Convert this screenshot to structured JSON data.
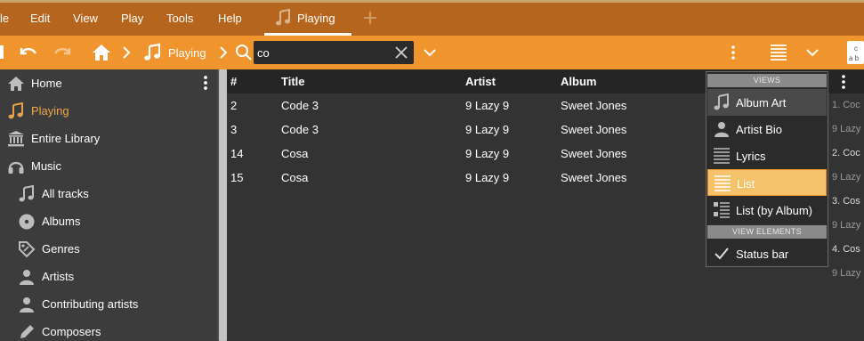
{
  "menubar": {
    "items": [
      "le",
      "Edit",
      "View",
      "Play",
      "Tools",
      "Help"
    ],
    "tab": {
      "label": "Playing",
      "icon": "music-note-icon"
    },
    "add_tab_icon": "plus-icon"
  },
  "toolbar": {
    "breadcrumb": [
      "Playing"
    ],
    "search": {
      "value": "co",
      "placeholder": ""
    },
    "icons": [
      "undo-icon",
      "redo-icon",
      "home-icon",
      "chevron-right-icon",
      "search-icon",
      "clear-icon",
      "chevron-down-icon",
      "kebab-menu-icon",
      "list-view-icon"
    ]
  },
  "sidebar": {
    "items": [
      {
        "label": "Home",
        "icon": "home-icon",
        "active": false
      },
      {
        "label": "Playing",
        "icon": "music-note-icon",
        "active": true
      },
      {
        "label": "Entire Library",
        "icon": "library-icon",
        "active": false
      },
      {
        "label": "Music",
        "icon": "headphones-icon",
        "active": false
      },
      {
        "label": "All tracks",
        "icon": "music-note-icon",
        "active": false
      },
      {
        "label": "Albums",
        "icon": "disc-icon",
        "active": false
      },
      {
        "label": "Genres",
        "icon": "tag-icon",
        "active": false
      },
      {
        "label": "Artists",
        "icon": "person-icon",
        "active": false
      },
      {
        "label": "Contributing artists",
        "icon": "person-icon",
        "active": false
      },
      {
        "label": "Composers",
        "icon": "pen-icon",
        "active": false
      }
    ]
  },
  "tracklist": {
    "columns": [
      "#",
      "Title",
      "Artist",
      "Album"
    ],
    "rows": [
      [
        "2",
        "Code 3",
        "9 Lazy 9",
        "Sweet Jones"
      ],
      [
        "3",
        "Code 3",
        "9 Lazy 9",
        "Sweet Jones"
      ],
      [
        "14",
        "Cosa",
        "9 Lazy 9",
        "Sweet Jones"
      ],
      [
        "15",
        "Cosa",
        "9 Lazy 9",
        "Sweet Jones"
      ]
    ]
  },
  "views_menu": {
    "views_header": "VIEWS",
    "views": [
      {
        "label": "Album Art",
        "icon": "music-note-icon",
        "state": "hover"
      },
      {
        "label": "Artist Bio",
        "icon": "person-icon",
        "state": ""
      },
      {
        "label": "Lyrics",
        "icon": "lines-icon",
        "state": ""
      },
      {
        "label": "List",
        "icon": "list-icon",
        "state": "selected"
      },
      {
        "label": "List (by Album)",
        "icon": "list-by-album-icon",
        "state": ""
      }
    ],
    "elements_header": "VIEW ELEMENTS",
    "elements": [
      {
        "label": "Status bar",
        "icon": "check-icon",
        "checked": true
      }
    ]
  },
  "right_panel": {
    "lines": [
      "1. Coc",
      "9 Lazy",
      "2. Coc",
      "9 Lazy",
      "3. Cos",
      "9 Lazy",
      "4. Cos",
      "9 Lazy"
    ]
  },
  "colors": {
    "menubar": "#b5651d",
    "toolbar": "#f0952d",
    "active_text": "#f0a848",
    "selected_bg": "#f3c26a"
  }
}
